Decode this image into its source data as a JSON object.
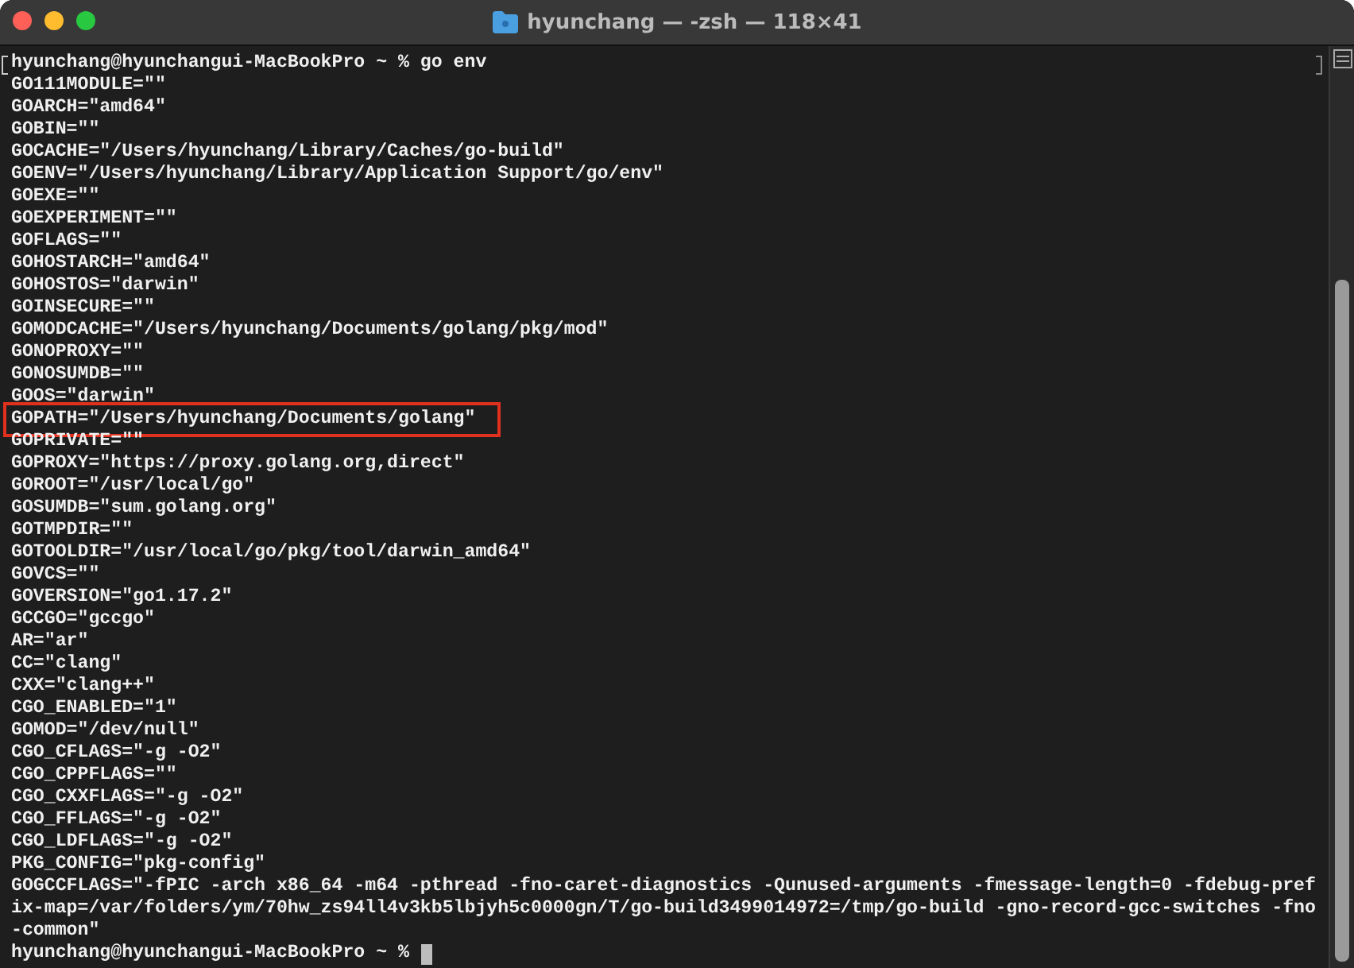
{
  "window": {
    "title": "hyunchang — -zsh — 118×41"
  },
  "terminal": {
    "lines": [
      {
        "text": "hyunchang@hyunchangui-MacBookPro ~ % go env",
        "kind": "prompt",
        "highlighted": false
      },
      {
        "text": "GO111MODULE=\"\"",
        "kind": "output",
        "highlighted": false
      },
      {
        "text": "GOARCH=\"amd64\"",
        "kind": "output",
        "highlighted": false
      },
      {
        "text": "GOBIN=\"\"",
        "kind": "output",
        "highlighted": false
      },
      {
        "text": "GOCACHE=\"/Users/hyunchang/Library/Caches/go-build\"",
        "kind": "output",
        "highlighted": false
      },
      {
        "text": "GOENV=\"/Users/hyunchang/Library/Application Support/go/env\"",
        "kind": "output",
        "highlighted": false
      },
      {
        "text": "GOEXE=\"\"",
        "kind": "output",
        "highlighted": false
      },
      {
        "text": "GOEXPERIMENT=\"\"",
        "kind": "output",
        "highlighted": false
      },
      {
        "text": "GOFLAGS=\"\"",
        "kind": "output",
        "highlighted": false
      },
      {
        "text": "GOHOSTARCH=\"amd64\"",
        "kind": "output",
        "highlighted": false
      },
      {
        "text": "GOHOSTOS=\"darwin\"",
        "kind": "output",
        "highlighted": false
      },
      {
        "text": "GOINSECURE=\"\"",
        "kind": "output",
        "highlighted": false
      },
      {
        "text": "GOMODCACHE=\"/Users/hyunchang/Documents/golang/pkg/mod\"",
        "kind": "output",
        "highlighted": false
      },
      {
        "text": "GONOPROXY=\"\"",
        "kind": "output",
        "highlighted": false
      },
      {
        "text": "GONOSUMDB=\"\"",
        "kind": "output",
        "highlighted": false
      },
      {
        "text": "GOOS=\"darwin\"",
        "kind": "output",
        "highlighted": false
      },
      {
        "text": "GOPATH=\"/Users/hyunchang/Documents/golang\"",
        "kind": "output",
        "highlighted": true
      },
      {
        "text": "GOPRIVATE=\"\"",
        "kind": "output",
        "highlighted": false
      },
      {
        "text": "GOPROXY=\"https://proxy.golang.org,direct\"",
        "kind": "output",
        "highlighted": false
      },
      {
        "text": "GOROOT=\"/usr/local/go\"",
        "kind": "output",
        "highlighted": false
      },
      {
        "text": "GOSUMDB=\"sum.golang.org\"",
        "kind": "output",
        "highlighted": false
      },
      {
        "text": "GOTMPDIR=\"\"",
        "kind": "output",
        "highlighted": false
      },
      {
        "text": "GOTOOLDIR=\"/usr/local/go/pkg/tool/darwin_amd64\"",
        "kind": "output",
        "highlighted": false
      },
      {
        "text": "GOVCS=\"\"",
        "kind": "output",
        "highlighted": false
      },
      {
        "text": "GOVERSION=\"go1.17.2\"",
        "kind": "output",
        "highlighted": false
      },
      {
        "text": "GCCGO=\"gccgo\"",
        "kind": "output",
        "highlighted": false
      },
      {
        "text": "AR=\"ar\"",
        "kind": "output",
        "highlighted": false
      },
      {
        "text": "CC=\"clang\"",
        "kind": "output",
        "highlighted": false
      },
      {
        "text": "CXX=\"clang++\"",
        "kind": "output",
        "highlighted": false
      },
      {
        "text": "CGO_ENABLED=\"1\"",
        "kind": "output",
        "highlighted": false
      },
      {
        "text": "GOMOD=\"/dev/null\"",
        "kind": "output",
        "highlighted": false
      },
      {
        "text": "CGO_CFLAGS=\"-g -O2\"",
        "kind": "output",
        "highlighted": false
      },
      {
        "text": "CGO_CPPFLAGS=\"\"",
        "kind": "output",
        "highlighted": false
      },
      {
        "text": "CGO_CXXFLAGS=\"-g -O2\"",
        "kind": "output",
        "highlighted": false
      },
      {
        "text": "CGO_FFLAGS=\"-g -O2\"",
        "kind": "output",
        "highlighted": false
      },
      {
        "text": "CGO_LDFLAGS=\"-g -O2\"",
        "kind": "output",
        "highlighted": false
      },
      {
        "text": "PKG_CONFIG=\"pkg-config\"",
        "kind": "output",
        "highlighted": false
      },
      {
        "text": "GOGCCFLAGS=\"-fPIC -arch x86_64 -m64 -pthread -fno-caret-diagnostics -Qunused-arguments -fmessage-length=0 -fdebug-pref",
        "kind": "output",
        "highlighted": false
      },
      {
        "text": "ix-map=/var/folders/ym/70hw_zs94ll4v3kb5lbjyh5c0000gn/T/go-build3499014972=/tmp/go-build -gno-record-gcc-switches -fno",
        "kind": "output",
        "highlighted": false
      },
      {
        "text": "-common\"",
        "kind": "output",
        "highlighted": false
      },
      {
        "text": "hyunchang@hyunchangui-MacBookPro ~ %",
        "kind": "cursor",
        "highlighted": false
      }
    ]
  }
}
